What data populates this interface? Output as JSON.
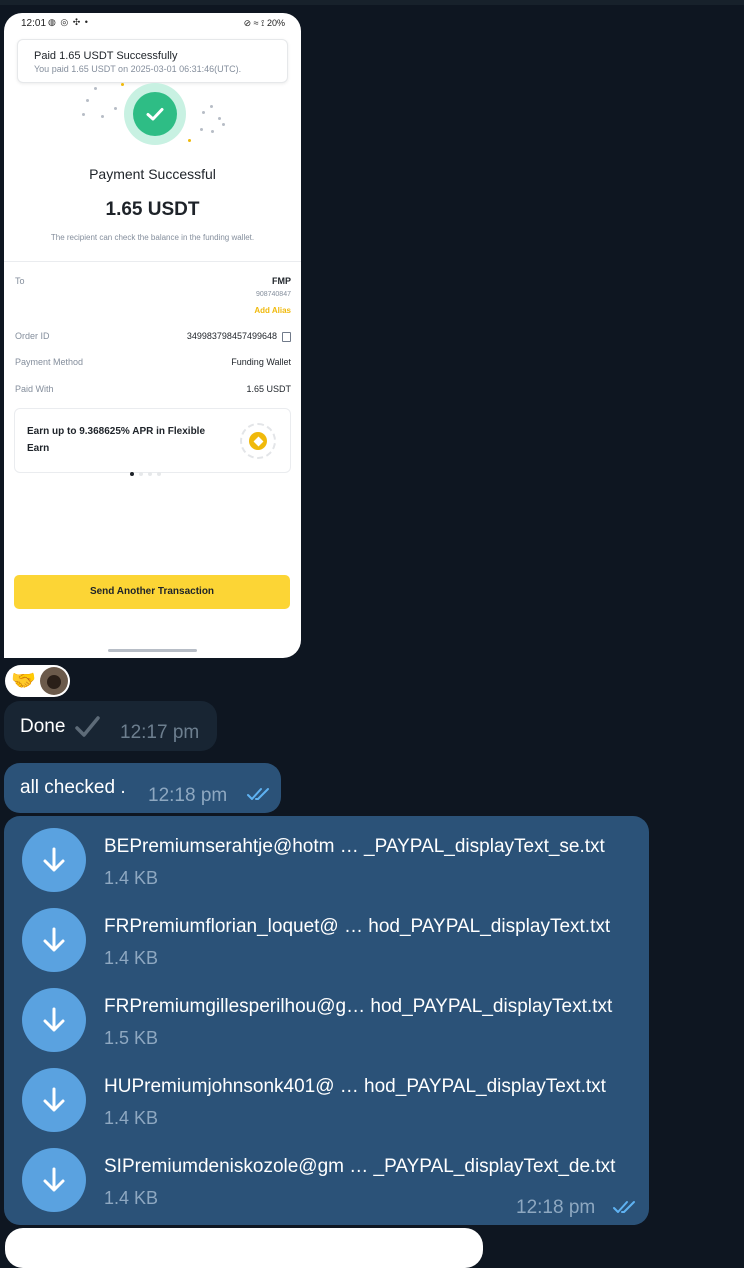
{
  "phone": {
    "status_time": "12:01",
    "status_battery": "20%",
    "toast_title": "Paid 1.65 USDT Successfully",
    "toast_subtitle": "You paid 1.65 USDT on 2025-03-01 06:31:46(UTC).",
    "success_title": "Payment Successful",
    "amount": "1.65 USDT",
    "note": "The recipient can check the balance in the funding wallet.",
    "details": {
      "to_label": "To",
      "to_name": "FMP",
      "to_id": "908740847",
      "add_alias": "Add Alias",
      "order_label": "Order ID",
      "order_value": "349983798457499648",
      "method_label": "Payment Method",
      "method_value": "Funding Wallet",
      "paid_label": "Paid With",
      "paid_value": "1.65 USDT"
    },
    "earn_card_text": "Earn up to 9.368625% APR in Flexible Earn",
    "send_button": "Send Another Transaction"
  },
  "chat": {
    "messages": [
      {
        "text": "Done",
        "time": "12:17 pm",
        "direction": "incoming"
      },
      {
        "text": "all checked .",
        "time": "12:18 pm",
        "direction": "outgoing",
        "status": "read"
      }
    ],
    "files_time": "12:18 pm",
    "files": [
      {
        "name": "BEPremiumserahtje@hotm  …  _PAYPAL_displayText_se.txt",
        "size": "1.4 KB"
      },
      {
        "name": "FRPremiumflorian_loquet@ … hod_PAYPAL_displayText.txt",
        "size": "1.4 KB"
      },
      {
        "name": "FRPremiumgillesperilhou@g… hod_PAYPAL_displayText.txt",
        "size": "1.5 KB"
      },
      {
        "name": "HUPremiumjohnsonk401@ … hod_PAYPAL_displayText.txt",
        "size": "1.4 KB"
      },
      {
        "name": "SIPremiumdeniskozole@gm … _PAYPAL_displayText_de.txt",
        "size": "1.4 KB"
      }
    ]
  },
  "colors": {
    "chat_background": "#0e1621",
    "incoming_bubble": "#182533",
    "outgoing_bubble": "#2b5278",
    "file_icon": "#5aa2e0",
    "success_green": "#2ebd85",
    "binance_yellow": "#fcd535"
  },
  "icons": [
    "check-icon",
    "copy-icon",
    "coin-icon",
    "download-arrow-icon",
    "double-check-icon",
    "single-check-icon",
    "handshake-emoji"
  ]
}
